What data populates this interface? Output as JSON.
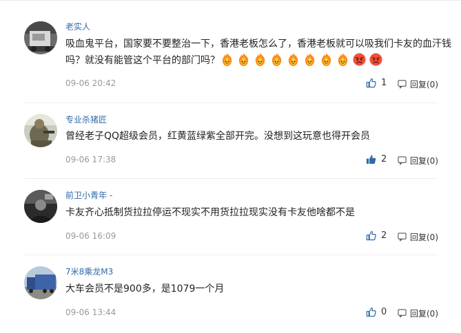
{
  "comments": [
    {
      "username": "老实人",
      "text": "吸血鬼平台，国家要不要整治一下，香港老板怎么了，香港老板就可以吸我们卡友的血汗钱吗？就没有能管这个平台的部门吗？",
      "emojis": [
        "angry-fire-icon",
        "angry-fire-icon",
        "angry-fire-icon",
        "angry-fire-icon",
        "angry-fire-icon",
        "angry-fire-icon",
        "angry-fire-icon",
        "angry-fire-icon",
        "angry-face-icon",
        "angry-face-icon"
      ],
      "time": "09-06 20:42",
      "likes": "1",
      "liked": false,
      "reply": "回复(0)"
    },
    {
      "username": "专业杀猪匠",
      "text": "曾经老子QQ超级会员，红黄蓝绿紫全部开完。没想到这玩意也得开会员",
      "emojis": [],
      "time": "09-06 17:38",
      "likes": "2",
      "liked": true,
      "reply": "回复(0)"
    },
    {
      "username": "前卫小青年 -",
      "text": "卡友齐心抵制货拉拉停运不现实不用货拉拉现实没有卡友他啥都不是",
      "emojis": [],
      "time": "09-06 16:09",
      "likes": "2",
      "liked": false,
      "reply": "回复(0)"
    },
    {
      "username": "7米8乘龙M3",
      "text": "大车会员不是900多，是1079一个月",
      "emojis": [],
      "time": "09-06 13:44",
      "likes": "0",
      "liked": false,
      "reply": "回复(0)"
    }
  ],
  "colors": {
    "username": "#2f6aa8",
    "time": "#999999",
    "like_active": "#2f6aa8"
  }
}
